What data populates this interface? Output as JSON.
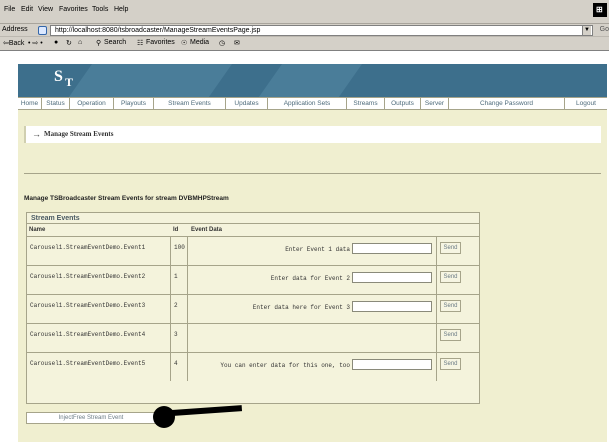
{
  "menu": [
    "File",
    "Edit",
    "View",
    "Favorites",
    "Tools",
    "Help"
  ],
  "address": {
    "label": "Address",
    "url": "http://localhost:8080/tsbroadcaster/ManageStreamEventsPage.jsp",
    "go": "Go"
  },
  "toolbar": {
    "back": "⇦Back",
    "arrows": "• ⇨ •",
    "search": "Search",
    "favorites": "Favorites",
    "media": "Media"
  },
  "logo": {
    "s": "S",
    "t": "T"
  },
  "nav": [
    "Home",
    "Status",
    "Operation",
    "Playouts",
    "Stream Events",
    "Updates",
    "Application Sets",
    "Streams",
    "Outputs",
    "Server",
    "Change Password",
    "Logout"
  ],
  "section_title": "Manage Stream Events",
  "caption": "Manage TSBroadcaster Stream Events for stream DVBMHPStream",
  "table": {
    "title": "Stream Events",
    "headers": {
      "name": "Name",
      "id": "Id",
      "event_data": "Event Data"
    },
    "rows": [
      {
        "name": "Carousel1.StreamEventDemo.Event1",
        "id": "100",
        "label": "Enter Event 1 data",
        "button": "Send"
      },
      {
        "name": "Carousel1.StreamEventDemo.Event2",
        "id": "1",
        "label": "Enter data for Event 2",
        "button": "Send"
      },
      {
        "name": "Carousel1.StreamEventDemo.Event3",
        "id": "2",
        "label": "Enter data here for Event 3",
        "button": "Send"
      },
      {
        "name": "Carousel1.StreamEventDemo.Event4",
        "id": "3",
        "label": "",
        "button": "Send"
      },
      {
        "name": "Carousel1.StreamEventDemo.Event5",
        "id": "4",
        "label": "You can enter data for this one, too",
        "button": "Send"
      }
    ]
  },
  "inject_button": "InjectFree Stream Event",
  "colors": {
    "banner": "#3d6f8c",
    "panel": "#f0efd0",
    "nav_text": "#4d6a7a",
    "border": "#a6a48a"
  }
}
